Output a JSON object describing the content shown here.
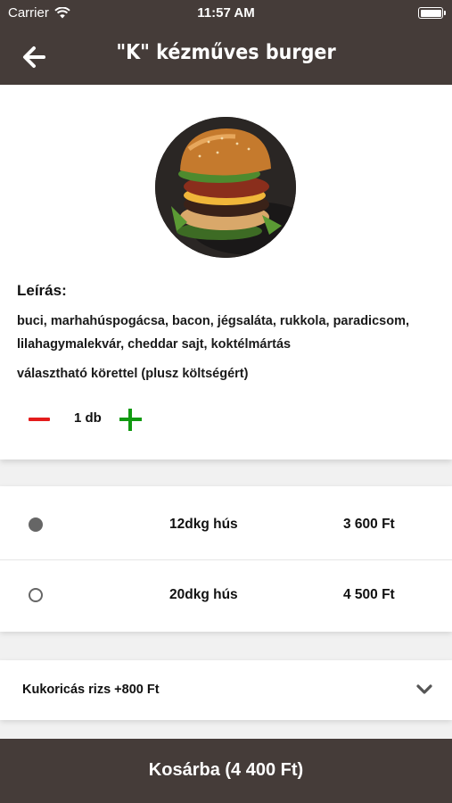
{
  "status_bar": {
    "carrier": "Carrier",
    "time": "11:57 AM"
  },
  "header": {
    "title": "\"K\" kézműves burger"
  },
  "product": {
    "description_label": "Leírás:",
    "description": "buci, marhahúspogácsa, bacon, jégsaláta, rukkola, paradicsom, lilahagymalekvár, cheddar sajt, koktélmártás",
    "note": "választható körettel (plusz költségért)",
    "quantity": "1 db"
  },
  "options": [
    {
      "name": "12dkg hús",
      "price": "3 600 Ft",
      "selected": true
    },
    {
      "name": "20dkg hús",
      "price": "4 500 Ft",
      "selected": false
    }
  ],
  "side_dish": {
    "label": "Kukoricás rizs +800 Ft"
  },
  "cart": {
    "label": "Kosárba (4 400 Ft)"
  },
  "colors": {
    "header_bg": "#453c39",
    "minus": "#e41c1c",
    "plus": "#119a11",
    "radio": "#666666"
  }
}
